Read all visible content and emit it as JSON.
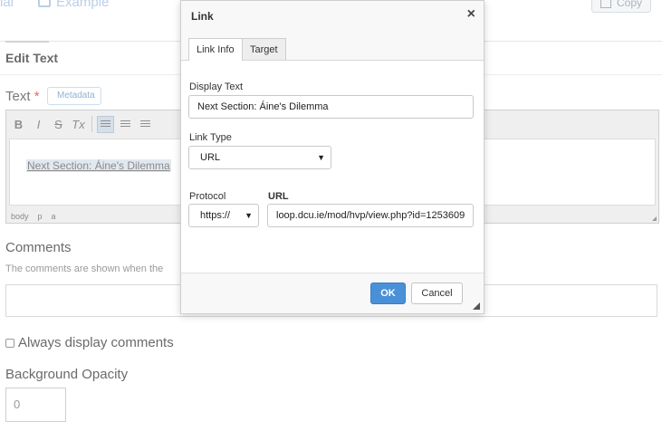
{
  "top_tabs": {
    "tab1": "ial",
    "tab2": "Example"
  },
  "copy_button": "Copy",
  "edit_text_heading": "Edit Text",
  "text_field": {
    "label": "Text",
    "required_mark": "*",
    "metadata_badge": "Metadata"
  },
  "editor": {
    "toolbar": {
      "bold": "B",
      "italic": "I",
      "strike": "S",
      "clear": "Tx"
    },
    "content_link": "Next Section: Áine's Dilemma",
    "path": [
      "body",
      "p",
      "a"
    ]
  },
  "comments": {
    "label": "Comments",
    "help": "The comments are shown when the"
  },
  "always_display": {
    "label": "Always display comments"
  },
  "background_opacity": {
    "label": "Background Opacity",
    "value": "0"
  },
  "dialog": {
    "title": "Link",
    "close": "×",
    "tabs": [
      "Link Info",
      "Target"
    ],
    "display_text": {
      "label": "Display Text",
      "value": "Next Section: Áine's Dilemma"
    },
    "link_type": {
      "label": "Link Type",
      "value": "URL"
    },
    "protocol": {
      "label": "Protocol",
      "value": "https://"
    },
    "url": {
      "label": "URL",
      "value": "loop.dcu.ie/mod/hvp/view.php?id=1253609"
    },
    "ok": "OK",
    "cancel": "Cancel"
  },
  "colors": {
    "accent": "#4a90d9",
    "required": "#e26a6a",
    "dim_text": "#8a8a8a"
  }
}
